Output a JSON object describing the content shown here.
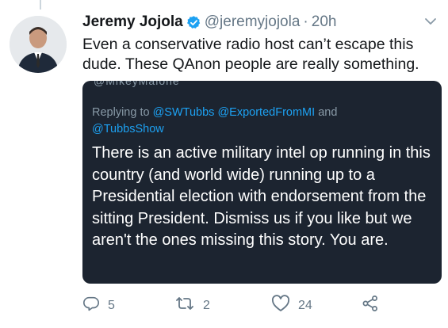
{
  "tweet": {
    "author_name": "Jeremy Jojola",
    "handle": "@jeremyjojola",
    "separator": "·",
    "time": "20h",
    "text": "Even a conservative radio host can’t escape this dude. These QAnon people are really something."
  },
  "quote": {
    "cut_text": "@MikeyMalone",
    "replying_prefix": "Replying to",
    "mention_1": "@SWTubbs",
    "mention_2": "@ExportedFromMI",
    "and_word": "and",
    "mention_3": "@TubbsShow",
    "body": "There is an active military intel op running in this country (and world wide) running up to a Presidential election with endorsement from the sitting President. Dismiss us if you like but we aren't the ones missing this story. You are."
  },
  "actions": {
    "reply_count": "5",
    "retweet_count": "2",
    "like_count": "24"
  },
  "icons": [
    "verified-badge-icon",
    "chevron-down-icon",
    "reply-icon",
    "retweet-icon",
    "like-icon",
    "share-icon"
  ],
  "colors": {
    "accent": "#1da1f2",
    "quote_background": "#1c2430",
    "muted_text": "#657786"
  }
}
